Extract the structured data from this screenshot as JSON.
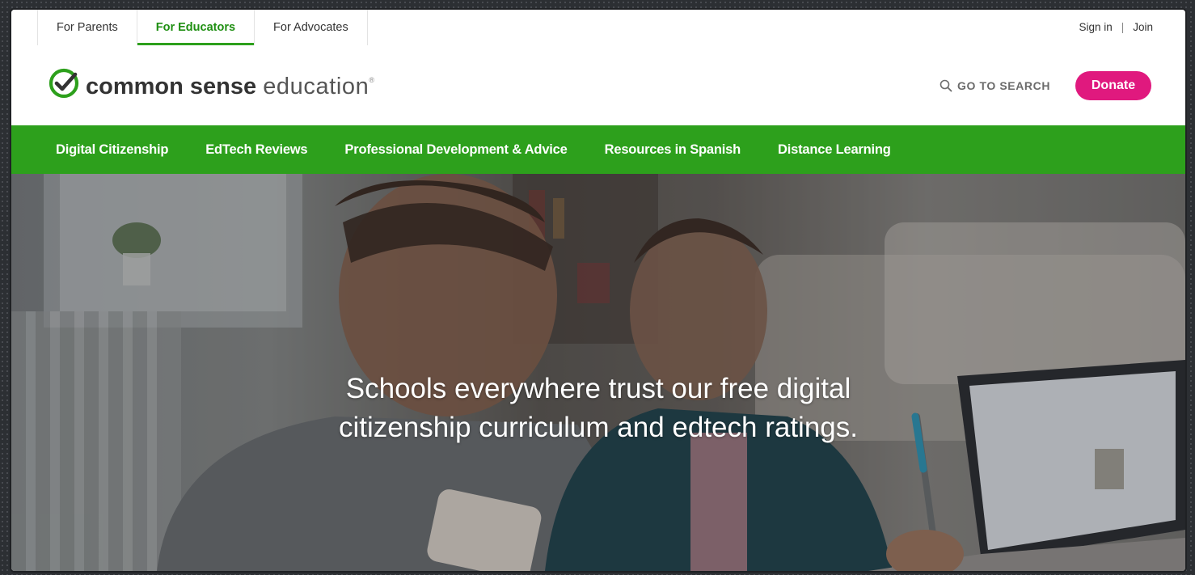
{
  "audience_tabs": [
    {
      "label": "For Parents",
      "active": false
    },
    {
      "label": "For Educators",
      "active": true
    },
    {
      "label": "For Advocates",
      "active": false
    }
  ],
  "account": {
    "sign_in": "Sign in",
    "separator": "|",
    "join": "Join"
  },
  "brand": {
    "name_bold": "common sense",
    "name_light": "education",
    "mark": "®"
  },
  "search": {
    "label": "GO TO SEARCH",
    "icon": "search-icon"
  },
  "donate": {
    "label": "Donate"
  },
  "main_nav": [
    "Digital Citizenship",
    "EdTech Reviews",
    "Professional Development & Advice",
    "Resources in Spanish",
    "Distance Learning"
  ],
  "hero": {
    "headline_line1": "Schools everywhere trust our free digital",
    "headline_line2": "citizenship curriculum and edtech ratings."
  },
  "colors": {
    "brand_green": "#2da01c",
    "donate_pink": "#e0197e"
  }
}
